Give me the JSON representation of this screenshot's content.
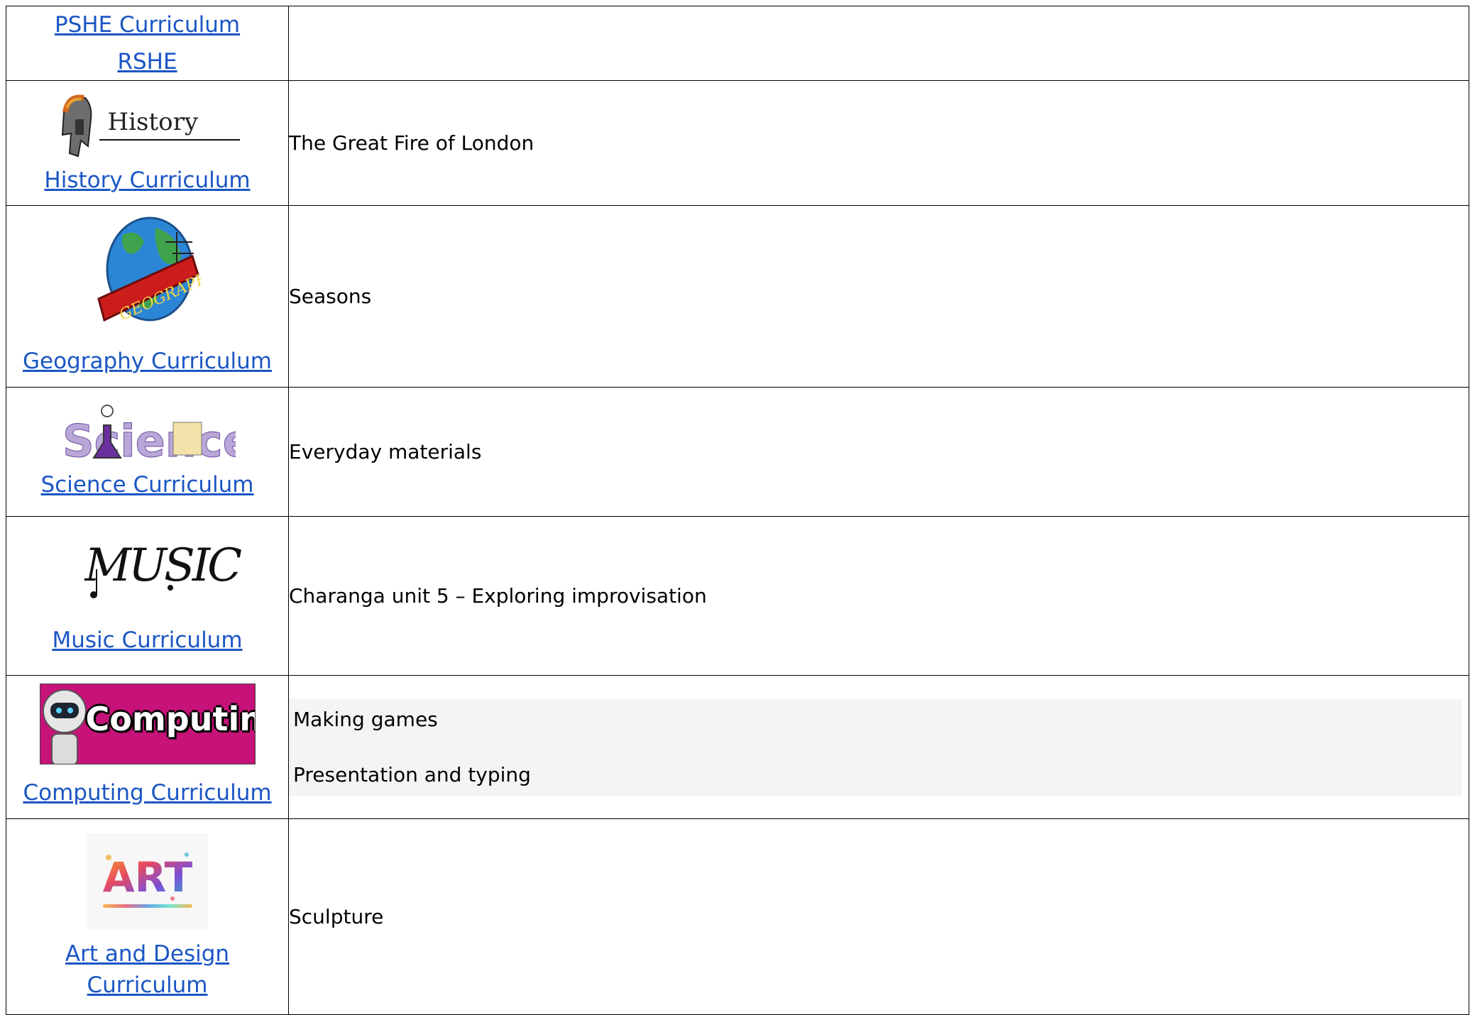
{
  "rows": [
    {
      "links": [
        "PSHE Curriculum",
        "RSHE"
      ],
      "topics": []
    },
    {
      "logo_text": "History",
      "logo_icon": "roman-helmet-icon",
      "links": [
        "History Curriculum"
      ],
      "topics": [
        "The Great Fire of London"
      ]
    },
    {
      "logo_text": "GEOGRAPHY",
      "logo_icon": "globe-icon",
      "links": [
        "Geography Curriculum"
      ],
      "topics": [
        "Seasons"
      ]
    },
    {
      "logo_text": "Science",
      "logo_icon": "science-flask-icon",
      "links": [
        "Science Curriculum"
      ],
      "topics": [
        "Everyday materials"
      ]
    },
    {
      "logo_text": "MUSIC",
      "logo_icon": "music-notes-icon",
      "links": [
        "Music Curriculum"
      ],
      "topics": [
        "Charanga unit 5 – Exploring improvisation"
      ]
    },
    {
      "logo_text": "Computing",
      "logo_icon": "robot-icon",
      "links": [
        "Computing Curriculum"
      ],
      "topics": [
        "Making games",
        "Presentation and typing"
      ]
    },
    {
      "logo_text": "ART",
      "logo_icon": "paint-splash-icon",
      "links": [
        "Art and Design",
        "Curriculum"
      ],
      "topics": [
        "Sculpture"
      ]
    }
  ],
  "colors": {
    "link": "#1a56c4",
    "computing_bg": "#c7127a",
    "border": "#000000"
  }
}
